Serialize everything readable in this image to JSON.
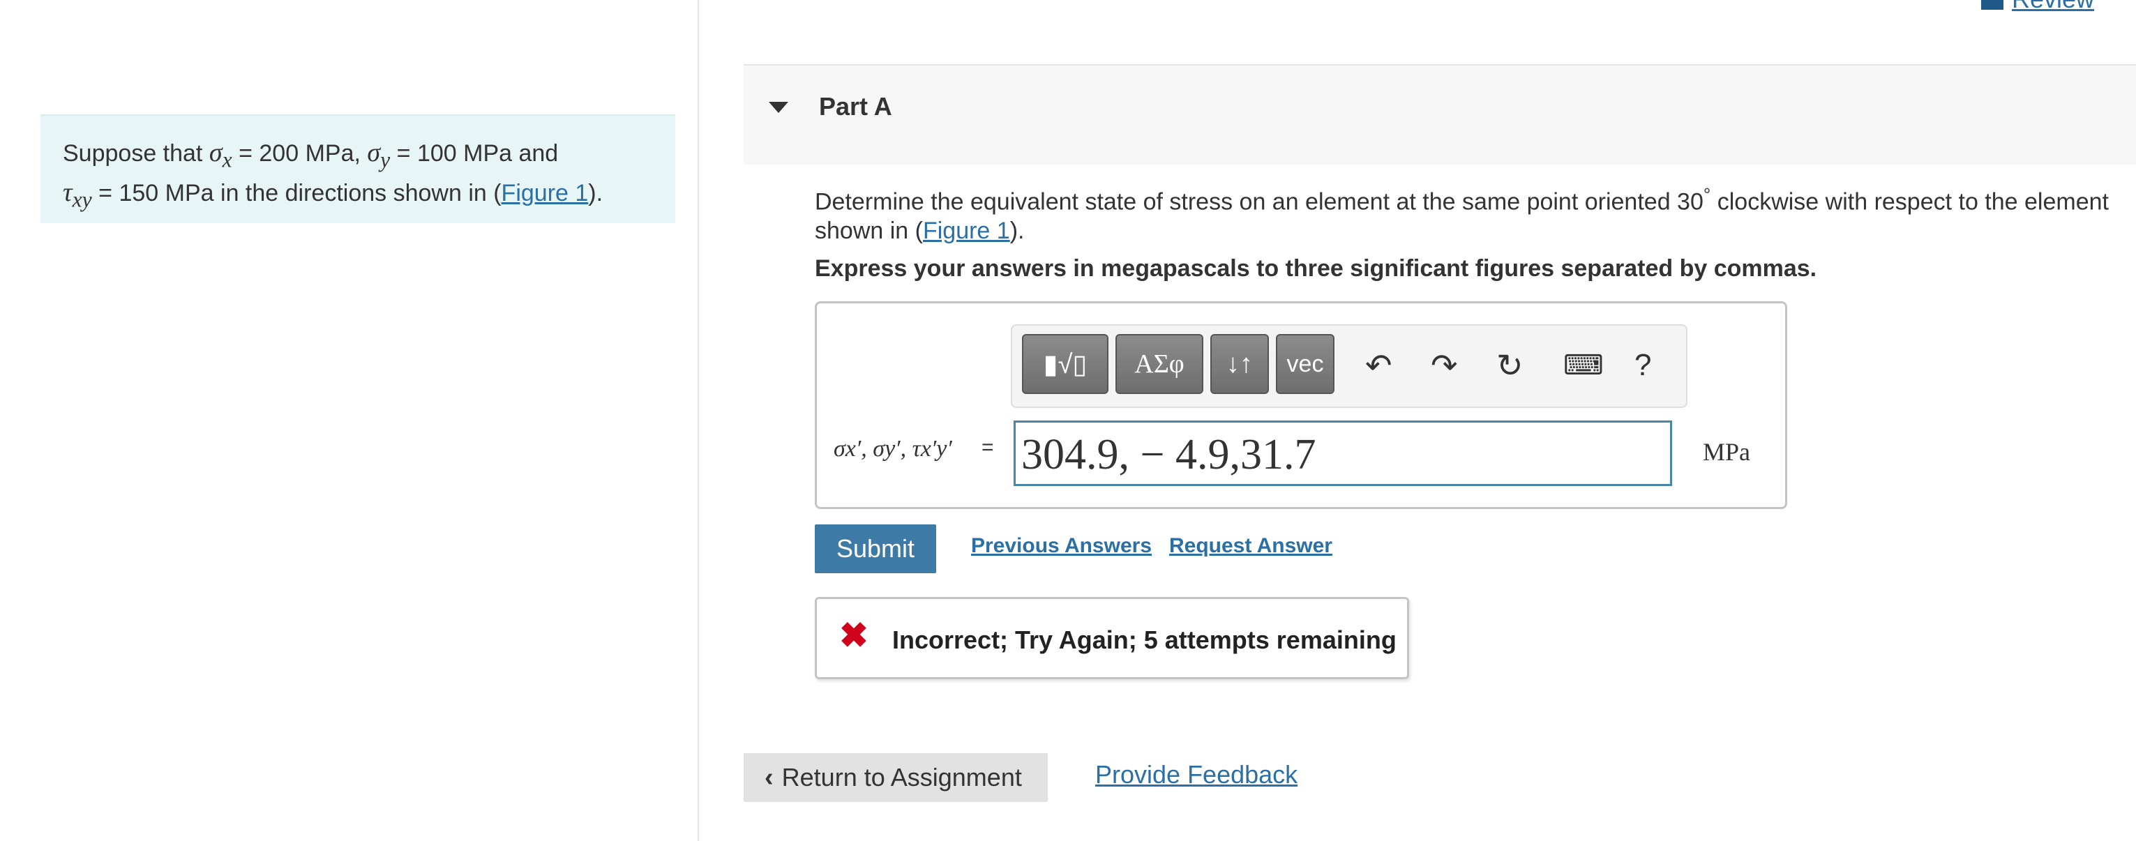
{
  "header": {
    "review_label": "Review"
  },
  "intro": {
    "text_1": "Suppose that ",
    "sx_sym": "σ",
    "sx_sub": "x",
    "sx_val": " = 200 MPa",
    "comma": ", ",
    "sy_sym": "σ",
    "sy_sub": "y",
    "sy_val": " = 100 MPa",
    "and": " and",
    "txy_sym": "τ",
    "txy_sub": "xy",
    "txy_val": " = 150 MPa",
    "text_2": " in the directions shown in (",
    "figure_link": "Figure 1",
    "text_3": ")."
  },
  "part": {
    "title": "Part A",
    "question_1": "Determine the equivalent state of stress on an element at the same point oriented 30",
    "degree": "°",
    "question_2": " clockwise with respect to the element shown in (",
    "figure_link": "Figure 1",
    "question_3": ").",
    "instruction": "Express your answers in megapascals to three significant figures separated by commas."
  },
  "toolbar": {
    "templates_label": "▮√▯",
    "symbols_label": "ΑΣφ",
    "arrows_label": "↓↑",
    "vec_label": "vec",
    "undo_icon": "↶",
    "redo_icon": "↷",
    "reset_icon": "↻",
    "keyboard_icon": "⌨",
    "help_label": "?"
  },
  "answer": {
    "variables_label": "σx′, σy′, τx′y′",
    "equals": "=",
    "value": "304.9, − 4.9,31.7",
    "unit": "MPa"
  },
  "actions": {
    "submit_label": "Submit",
    "previous_answers_label": "Previous Answers",
    "request_answer_label": "Request Answer"
  },
  "feedback": {
    "icon": "✖",
    "message": "Incorrect; Try Again; 5 attempts remaining"
  },
  "footer": {
    "return_label": "Return to Assignment",
    "provide_feedback_label": "Provide Feedback"
  },
  "colors": {
    "accent": "#3d7aa6",
    "link": "#2a6fa6",
    "error": "#d0021b",
    "intro_bg": "#e8f5f6"
  }
}
